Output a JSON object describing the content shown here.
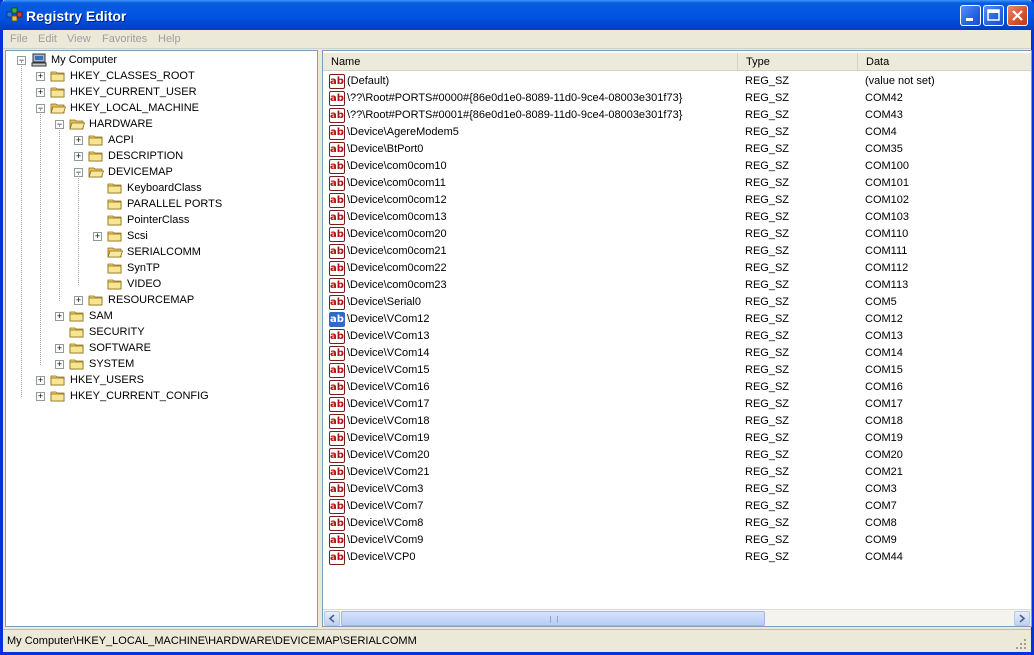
{
  "window": {
    "title": "Registry Editor",
    "accent": "#0055e5"
  },
  "menu": [
    "File",
    "Edit",
    "View",
    "Favorites",
    "Help"
  ],
  "tree": [
    {
      "label": "My Computer",
      "depth": 0,
      "expander": "minus",
      "icon": "computer-icon"
    },
    {
      "label": "HKEY_CLASSES_ROOT",
      "depth": 1,
      "expander": "plus",
      "icon": "folder-icon"
    },
    {
      "label": "HKEY_CURRENT_USER",
      "depth": 1,
      "expander": "plus",
      "icon": "folder-icon"
    },
    {
      "label": "HKEY_LOCAL_MACHINE",
      "depth": 1,
      "expander": "minus",
      "icon": "folder-open-icon"
    },
    {
      "label": "HARDWARE",
      "depth": 2,
      "expander": "minus",
      "icon": "folder-open-icon"
    },
    {
      "label": "ACPI",
      "depth": 3,
      "expander": "plus",
      "icon": "folder-icon"
    },
    {
      "label": "DESCRIPTION",
      "depth": 3,
      "expander": "plus",
      "icon": "folder-icon"
    },
    {
      "label": "DEVICEMAP",
      "depth": 3,
      "expander": "minus",
      "icon": "folder-open-icon"
    },
    {
      "label": "KeyboardClass",
      "depth": 4,
      "expander": "none",
      "icon": "folder-icon"
    },
    {
      "label": "PARALLEL PORTS",
      "depth": 4,
      "expander": "none",
      "icon": "folder-icon"
    },
    {
      "label": "PointerClass",
      "depth": 4,
      "expander": "none",
      "icon": "folder-icon"
    },
    {
      "label": "Scsi",
      "depth": 4,
      "expander": "plus",
      "icon": "folder-icon"
    },
    {
      "label": "SERIALCOMM",
      "depth": 4,
      "expander": "none",
      "icon": "folder-open-icon"
    },
    {
      "label": "SynTP",
      "depth": 4,
      "expander": "none",
      "icon": "folder-icon"
    },
    {
      "label": "VIDEO",
      "depth": 4,
      "expander": "none",
      "icon": "folder-icon"
    },
    {
      "label": "RESOURCEMAP",
      "depth": 3,
      "expander": "plus",
      "icon": "folder-icon"
    },
    {
      "label": "SAM",
      "depth": 2,
      "expander": "plus",
      "icon": "folder-icon"
    },
    {
      "label": "SECURITY",
      "depth": 2,
      "expander": "none",
      "icon": "folder-icon"
    },
    {
      "label": "SOFTWARE",
      "depth": 2,
      "expander": "plus",
      "icon": "folder-icon"
    },
    {
      "label": "SYSTEM",
      "depth": 2,
      "expander": "plus",
      "icon": "folder-icon"
    },
    {
      "label": "HKEY_USERS",
      "depth": 1,
      "expander": "plus",
      "icon": "folder-icon"
    },
    {
      "label": "HKEY_CURRENT_CONFIG",
      "depth": 1,
      "expander": "plus",
      "icon": "folder-icon"
    }
  ],
  "columns": {
    "name": "Name",
    "type": "Type",
    "data": "Data"
  },
  "value_icon_text": "ab",
  "rows": [
    {
      "name": "(Default)",
      "type": "REG_SZ",
      "data": "(value not set)"
    },
    {
      "name": "\\??\\Root#PORTS#0000#{86e0d1e0-8089-11d0-9ce4-08003e301f73}",
      "type": "REG_SZ",
      "data": "COM42"
    },
    {
      "name": "\\??\\Root#PORTS#0001#{86e0d1e0-8089-11d0-9ce4-08003e301f73}",
      "type": "REG_SZ",
      "data": "COM43"
    },
    {
      "name": "\\Device\\AgereModem5",
      "type": "REG_SZ",
      "data": "COM4"
    },
    {
      "name": "\\Device\\BtPort0",
      "type": "REG_SZ",
      "data": "COM35"
    },
    {
      "name": "\\Device\\com0com10",
      "type": "REG_SZ",
      "data": "COM100"
    },
    {
      "name": "\\Device\\com0com11",
      "type": "REG_SZ",
      "data": "COM101"
    },
    {
      "name": "\\Device\\com0com12",
      "type": "REG_SZ",
      "data": "COM102"
    },
    {
      "name": "\\Device\\com0com13",
      "type": "REG_SZ",
      "data": "COM103"
    },
    {
      "name": "\\Device\\com0com20",
      "type": "REG_SZ",
      "data": "COM110"
    },
    {
      "name": "\\Device\\com0com21",
      "type": "REG_SZ",
      "data": "COM111"
    },
    {
      "name": "\\Device\\com0com22",
      "type": "REG_SZ",
      "data": "COM112"
    },
    {
      "name": "\\Device\\com0com23",
      "type": "REG_SZ",
      "data": "COM113"
    },
    {
      "name": "\\Device\\Serial0",
      "type": "REG_SZ",
      "data": "COM5"
    },
    {
      "name": "\\Device\\VCom12",
      "type": "REG_SZ",
      "data": "COM12",
      "selected": true
    },
    {
      "name": "\\Device\\VCom13",
      "type": "REG_SZ",
      "data": "COM13"
    },
    {
      "name": "\\Device\\VCom14",
      "type": "REG_SZ",
      "data": "COM14"
    },
    {
      "name": "\\Device\\VCom15",
      "type": "REG_SZ",
      "data": "COM15"
    },
    {
      "name": "\\Device\\VCom16",
      "type": "REG_SZ",
      "data": "COM16"
    },
    {
      "name": "\\Device\\VCom17",
      "type": "REG_SZ",
      "data": "COM17"
    },
    {
      "name": "\\Device\\VCom18",
      "type": "REG_SZ",
      "data": "COM18"
    },
    {
      "name": "\\Device\\VCom19",
      "type": "REG_SZ",
      "data": "COM19"
    },
    {
      "name": "\\Device\\VCom20",
      "type": "REG_SZ",
      "data": "COM20"
    },
    {
      "name": "\\Device\\VCom21",
      "type": "REG_SZ",
      "data": "COM21"
    },
    {
      "name": "\\Device\\VCom3",
      "type": "REG_SZ",
      "data": "COM3"
    },
    {
      "name": "\\Device\\VCom7",
      "type": "REG_SZ",
      "data": "COM7"
    },
    {
      "name": "\\Device\\VCom8",
      "type": "REG_SZ",
      "data": "COM8"
    },
    {
      "name": "\\Device\\VCom9",
      "type": "REG_SZ",
      "data": "COM9"
    },
    {
      "name": "\\Device\\VCP0",
      "type": "REG_SZ",
      "data": "COM44"
    }
  ],
  "status": {
    "path": "My Computer\\HKEY_LOCAL_MACHINE\\HARDWARE\\DEVICEMAP\\SERIALCOMM"
  }
}
